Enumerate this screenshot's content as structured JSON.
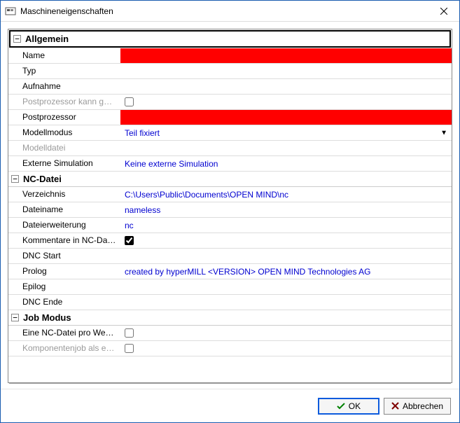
{
  "window": {
    "title": "Maschineneigenschaften"
  },
  "sections": {
    "allgemein": {
      "title": "Allgemein",
      "name_label": "Name",
      "typ_label": "Typ",
      "aufnahme_label": "Aufnahme",
      "postproc_save_label": "Postprozessor kann gesp...",
      "postproc_label": "Postprozessor",
      "modellmodus_label": "Modellmodus",
      "modellmodus_value": "Teil fixiert",
      "modelldatei_label": "Modelldatei",
      "ext_sim_label": "Externe Simulation",
      "ext_sim_value": "Keine externe Simulation"
    },
    "ncdatei": {
      "title": "NC-Datei",
      "verzeichnis_label": "Verzeichnis",
      "verzeichnis_value": "C:\\Users\\Public\\Documents\\OPEN MIND\\nc",
      "dateiname_label": "Dateiname",
      "dateiname_value": "nameless",
      "dateierw_label": "Dateierweiterung",
      "dateierw_value": "nc",
      "kommentare_label": "Kommentare in NC-Dat...",
      "dncstart_label": "DNC Start",
      "prolog_label": "Prolog",
      "prolog_value": "created by hyperMILL <VERSION> OPEN MIND Technologies AG",
      "epilog_label": "Epilog",
      "dncende_label": "DNC Ende"
    },
    "jobmodus": {
      "title": "Job Modus",
      "eine_nc_label": "Eine NC-Datei pro Werkz...",
      "komponentenjob_label": "Komponentenjob als ein..."
    }
  },
  "footer": {
    "ok": "OK",
    "cancel": "Abbrechen"
  }
}
